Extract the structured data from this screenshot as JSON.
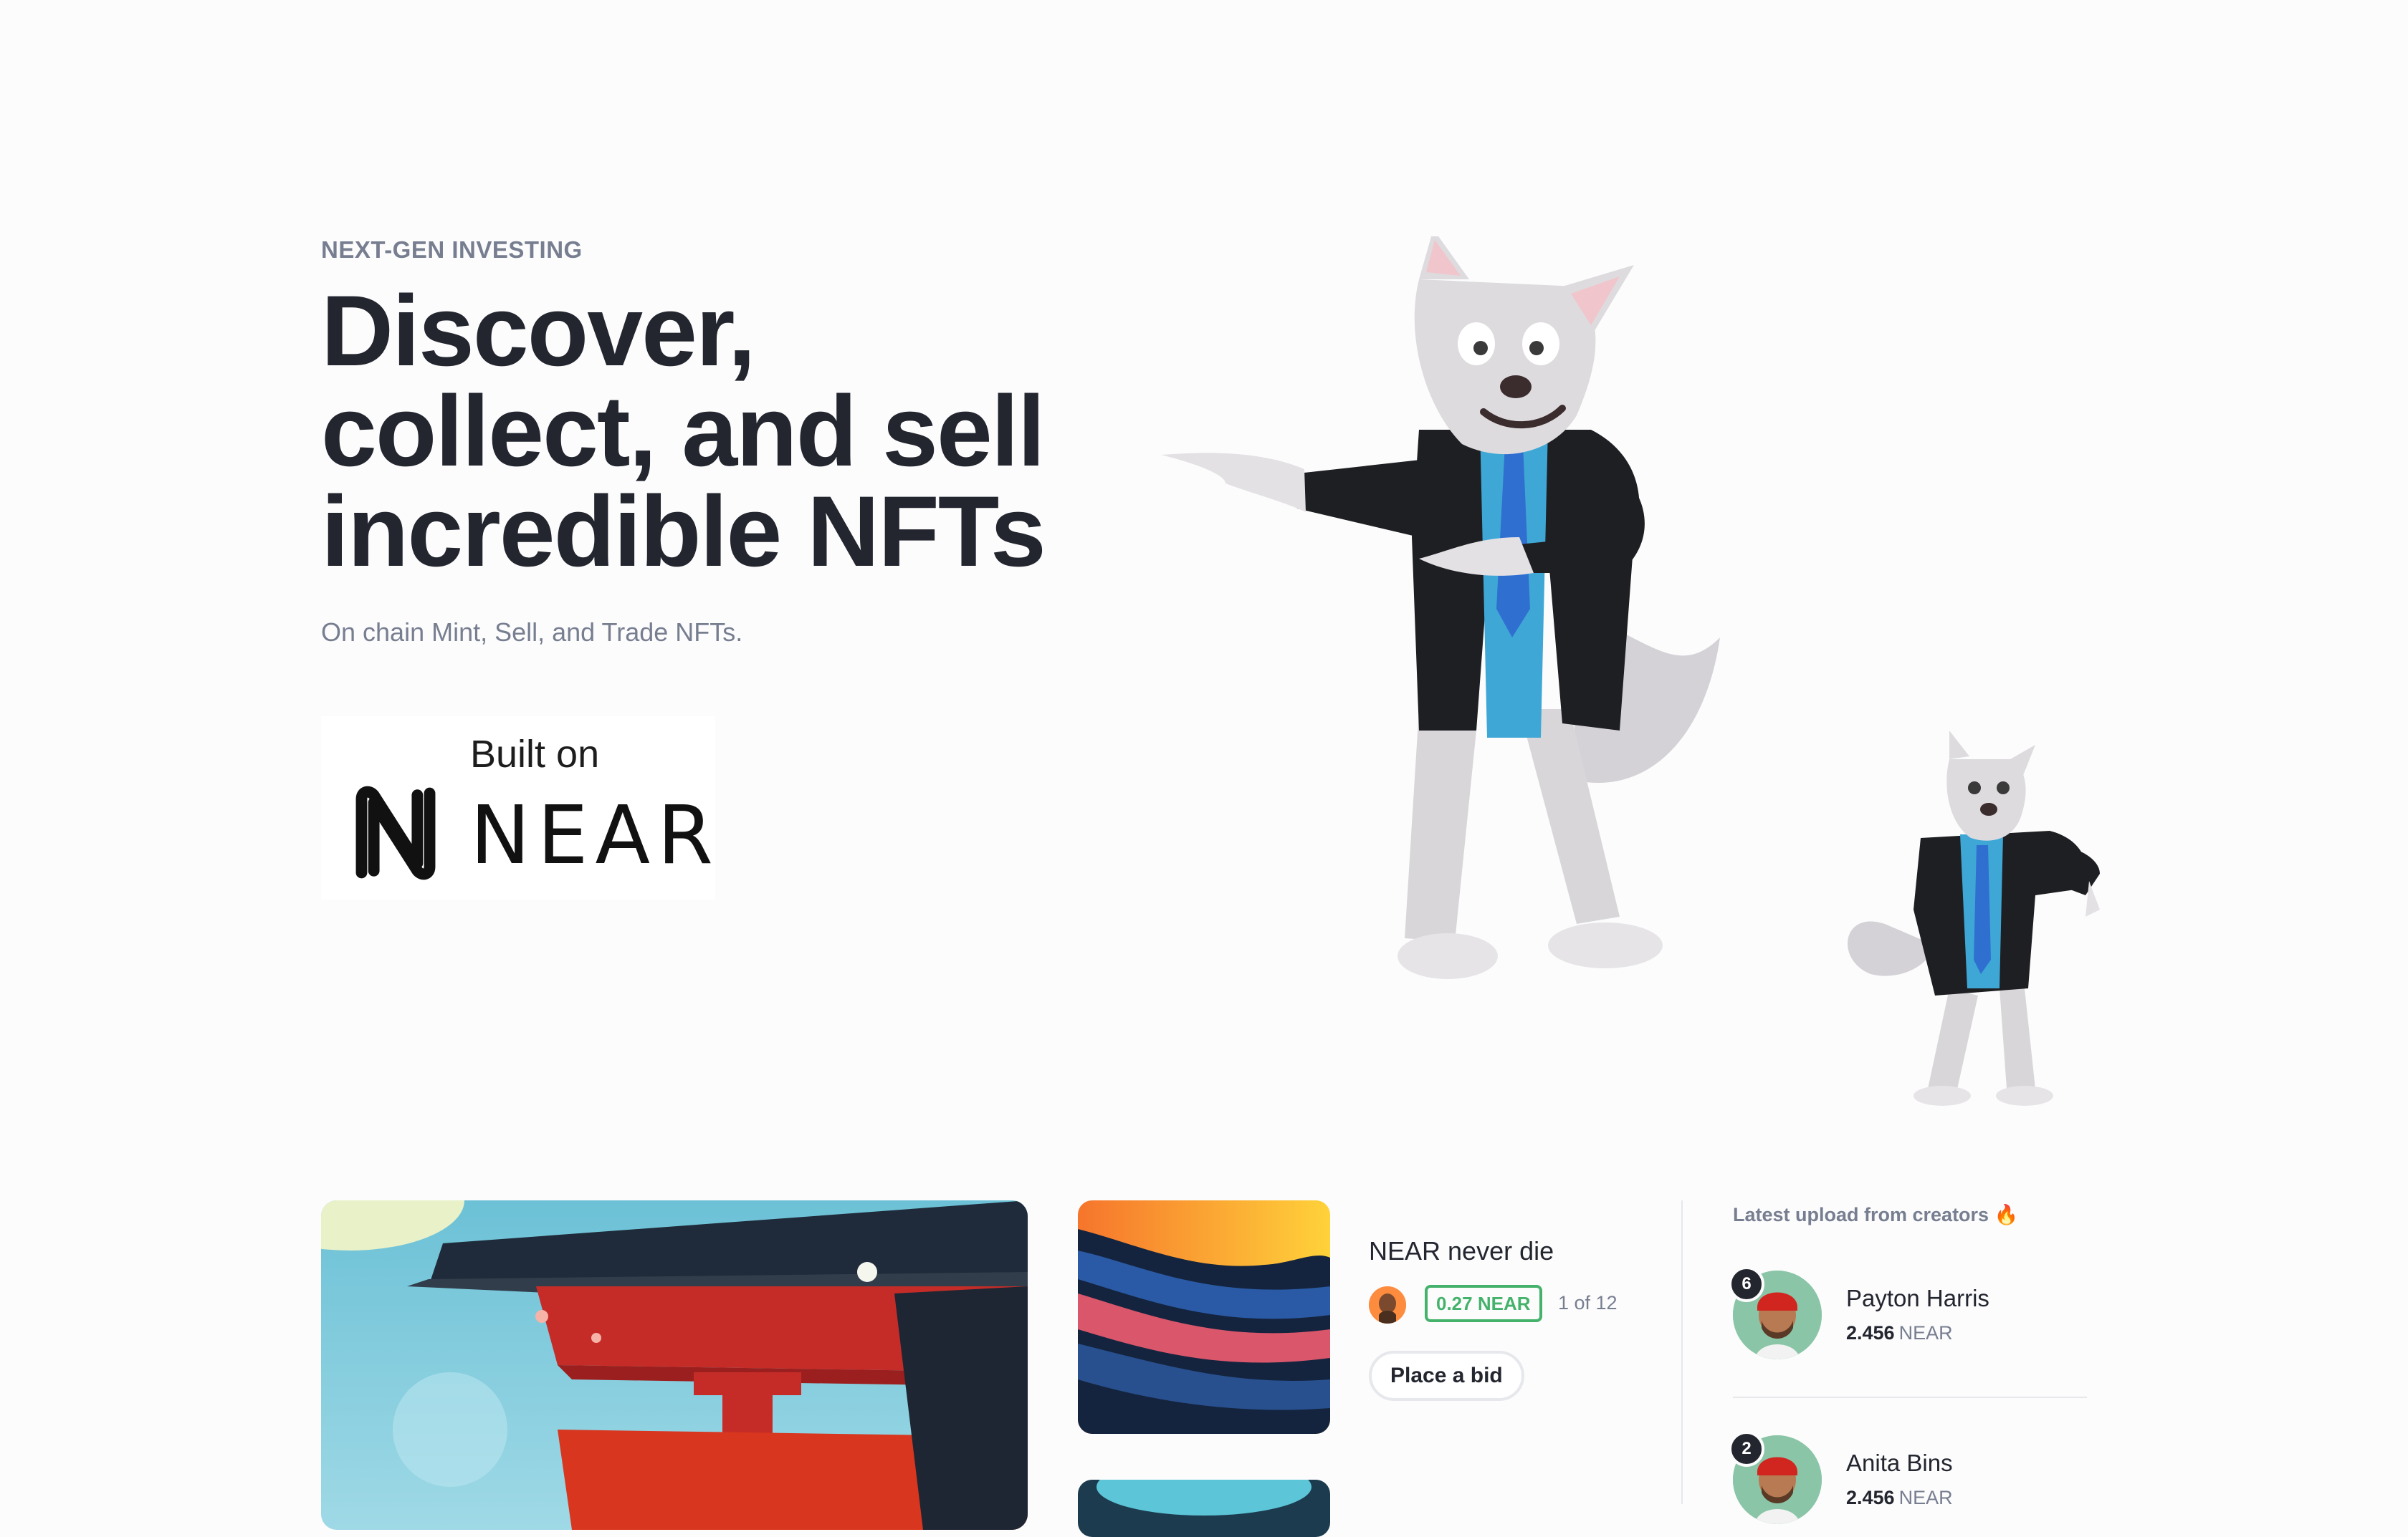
{
  "hero": {
    "eyebrow": "NEXT-GEN INVESTING",
    "title_lines": [
      "Discover,",
      "collect, and sell",
      "incredible NFTs"
    ],
    "subtitle": "On chain Mint, Sell, and Trade NFTs.",
    "badge": {
      "built_on": "Built on",
      "brand": "NEAR"
    }
  },
  "featured": {
    "item_title": "NEAR never die",
    "price": "0.27 NEAR",
    "stock": "1 of 12",
    "bid_label": "Place a bid",
    "accent_color": "#45b26b"
  },
  "creators": {
    "heading": "Latest upload from creators 🔥",
    "items": [
      {
        "rank": "6",
        "name": "Payton Harris",
        "amount": "2.456",
        "unit": "NEAR"
      },
      {
        "rank": "2",
        "name": "Anita Bins",
        "amount": "2.456",
        "unit": "NEAR"
      }
    ]
  },
  "colors": {
    "background": "#fcfcfd",
    "text_primary": "#23262f",
    "text_secondary": "#777e90",
    "border": "#e6e8ec"
  }
}
